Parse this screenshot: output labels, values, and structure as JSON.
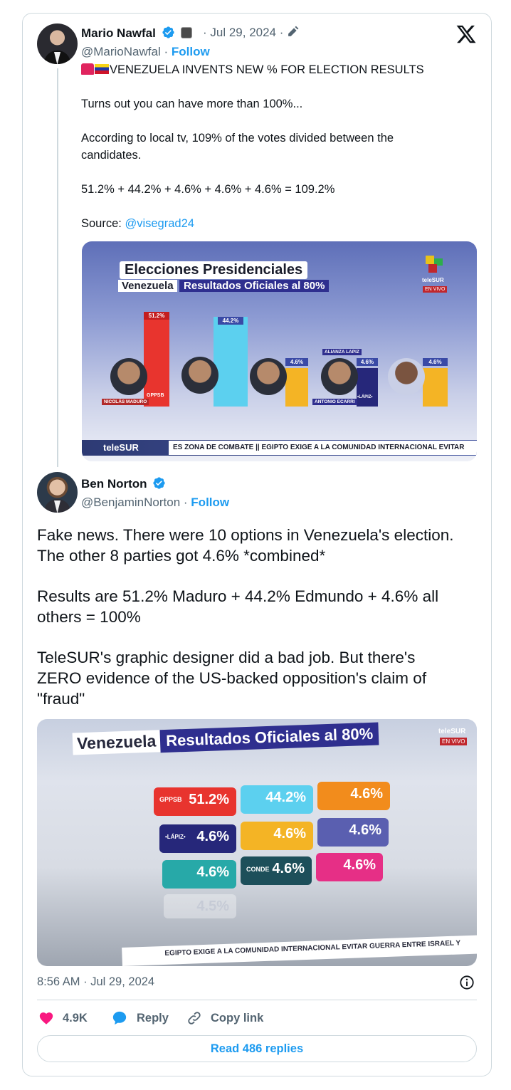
{
  "quoted_tweet": {
    "author_name": "Mario Nawfal",
    "date": "· Jul 29, 2024 ·",
    "handle": "@MarioNawfal",
    "separator": "·",
    "follow_label": "Follow",
    "text_lines": [
      "VENEZUELA INVENTS NEW % FOR ELECTION RESULTS",
      "Turns out you can have more than 100%...",
      "According to local tv, 109% of the votes divided between the",
      "candidates.",
      "51.2% + 44.2% + 4.6% + 4.6% + 4.6% = 109.2%",
      "Source:"
    ],
    "source_mention": "@visegrad24",
    "media": {
      "title": "Elecciones Presidenciales",
      "subtitle_country": "Venezuela",
      "subtitle_results": "Resultados Oficiales al 80%",
      "bar_values": [
        "51.2%",
        "44.2%",
        "4.6%",
        "4.6%",
        "4.6%"
      ],
      "candidate_names": [
        "NICOLÁS MADURO",
        "ANTONIO ECARRI"
      ],
      "party_labels": [
        "GPPSB",
        "ALIANZA LAPIZ",
        "•LÁPIZ•"
      ],
      "network_name": "teleSUR",
      "live_label": "EN VIVO",
      "ticker_brand": "teleSUR",
      "ticker_text": "ES ZONA DE COMBATE || EGIPTO EXIGE A LA COMUNIDAD INTERNACIONAL EVITAR"
    }
  },
  "main_tweet": {
    "author_name": "Ben Norton",
    "handle": "@BenjaminNorton",
    "separator": "·",
    "follow_label": "Follow",
    "text_lines": [
      "Fake news. There were 10 options in Venezuela's election.",
      "The other 8 parties got 4.6% *combined*",
      "Results are 51.2% Maduro + 44.2% Edmundo + 4.6% all",
      "others = 100%",
      "TeleSUR's graphic designer did a bad job. But there's",
      "ZERO evidence of the US-backed opposition's claim of",
      "\"fraud\""
    ],
    "media": {
      "subtitle_country": "Venezuela",
      "subtitle_results": "Resultados Oficiales al 80%",
      "tiles": [
        "51.2%",
        "44.2%",
        "4.6%",
        "4.6%",
        "4.6%",
        "4.6%",
        "4.6%",
        "4.6%",
        "4.6%",
        "4.5%"
      ],
      "tile_labels": [
        "GPPSB",
        "•LÁPIZ•",
        "CONDE"
      ],
      "network_name": "teleSUR",
      "live_label": "EN VIVO",
      "ticker_text": "EGIPTO EXIGE A LA COMUNIDAD INTERNACIONAL EVITAR GUERRA ENTRE ISRAEL Y"
    },
    "timestamp": "8:56 AM · Jul 29, 2024",
    "likes": "4.9K",
    "reply_label": "Reply",
    "copy_link_label": "Copy link",
    "read_replies_label": "Read 486 replies"
  },
  "colors": {
    "accent": "#1d9bf0",
    "text": "#0f1419",
    "muted": "#536471",
    "border": "#cfd9de",
    "like": "#f91880"
  },
  "icons": [
    "verified-badge-icon",
    "x-logo-icon",
    "info-icon",
    "heart-icon",
    "reply-bubble-icon",
    "link-icon",
    "pencil-icon"
  ]
}
